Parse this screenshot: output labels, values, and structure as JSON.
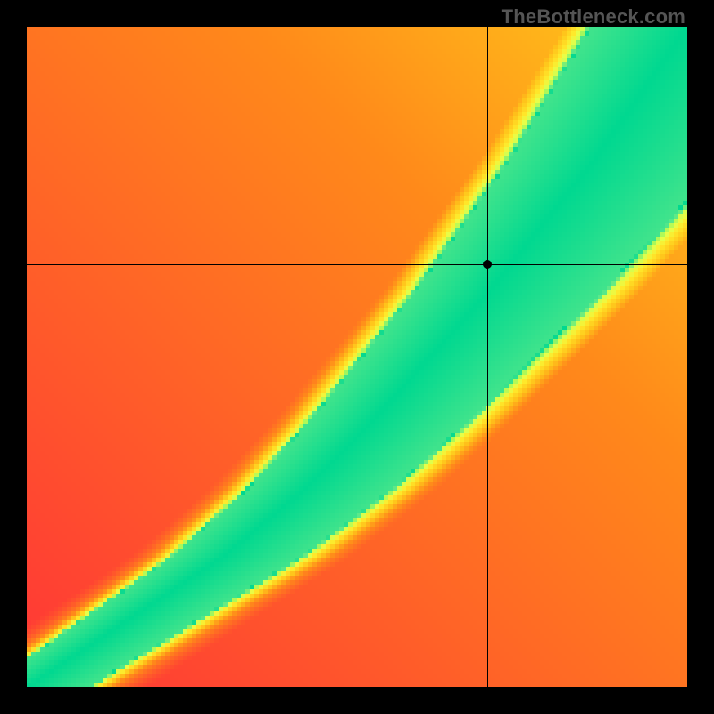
{
  "watermark": "TheBottleneck.com",
  "chart_data": {
    "type": "heatmap",
    "title": "",
    "xlabel": "",
    "ylabel": "",
    "xlim": [
      0,
      1
    ],
    "ylim": [
      0,
      1
    ],
    "grid": false,
    "legend": false,
    "crosshair": {
      "x": 0.697,
      "y": 0.64
    },
    "marker": {
      "x": 0.697,
      "y": 0.64
    },
    "color_stops": [
      {
        "t": 0.0,
        "color": "#ff2a3a"
      },
      {
        "t": 0.2,
        "color": "#ff5a2a"
      },
      {
        "t": 0.4,
        "color": "#ff8a1a"
      },
      {
        "t": 0.55,
        "color": "#ffc21a"
      },
      {
        "t": 0.7,
        "color": "#ffe82a"
      },
      {
        "t": 0.8,
        "color": "#e6ff4a"
      },
      {
        "t": 0.88,
        "color": "#a8f85a"
      },
      {
        "t": 0.93,
        "color": "#5ae88a"
      },
      {
        "t": 1.0,
        "color": "#00d890"
      }
    ],
    "ridge": {
      "points": [
        [
          0.0,
          0.0
        ],
        [
          0.15,
          0.1
        ],
        [
          0.3,
          0.2
        ],
        [
          0.42,
          0.3
        ],
        [
          0.52,
          0.4
        ],
        [
          0.61,
          0.5
        ],
        [
          0.7,
          0.6
        ],
        [
          0.78,
          0.7
        ],
        [
          0.86,
          0.8
        ],
        [
          0.93,
          0.9
        ],
        [
          1.0,
          1.0
        ]
      ],
      "base_half_width": 0.06,
      "width_growth": 0.085,
      "asymmetry": 0.55
    },
    "field_falloff": 0.95,
    "resolution": 148
  }
}
